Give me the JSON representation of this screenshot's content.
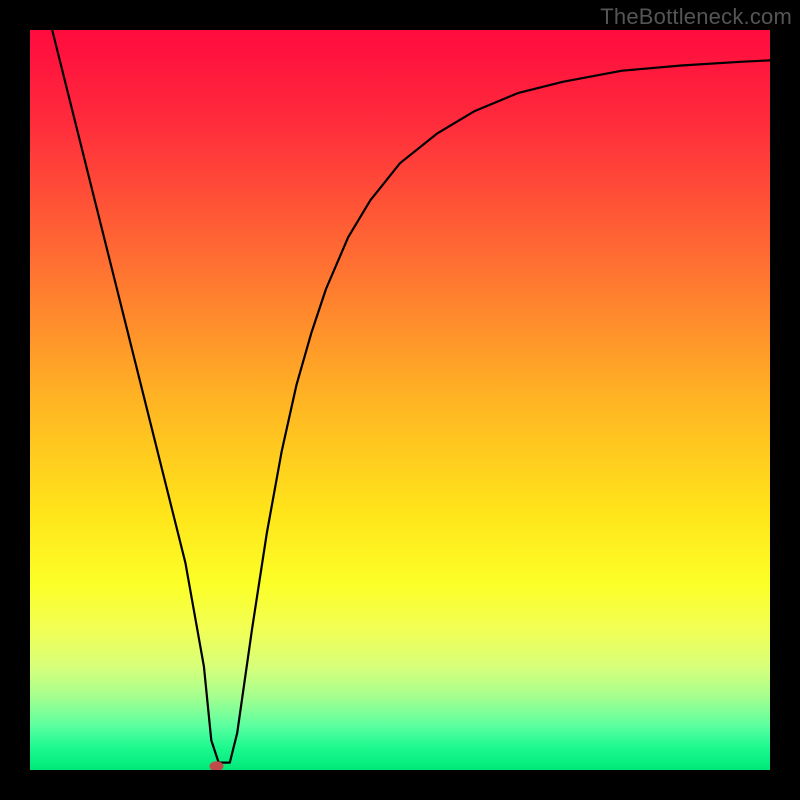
{
  "watermark": "TheBottleneck.com",
  "chart_data": {
    "type": "line",
    "title": "",
    "xlabel": "",
    "ylabel": "",
    "xlim": [
      0,
      100
    ],
    "ylim": [
      0,
      100
    ],
    "background_gradient": {
      "stops": [
        {
          "offset": 0,
          "color": "#ff0b3e"
        },
        {
          "offset": 12,
          "color": "#ff2a3c"
        },
        {
          "offset": 30,
          "color": "#ff6a33"
        },
        {
          "offset": 50,
          "color": "#ffb423"
        },
        {
          "offset": 65,
          "color": "#ffe41a"
        },
        {
          "offset": 75,
          "color": "#fcff28"
        },
        {
          "offset": 81,
          "color": "#f1ff55"
        },
        {
          "offset": 86,
          "color": "#d8ff7a"
        },
        {
          "offset": 90,
          "color": "#a6ff8e"
        },
        {
          "offset": 94,
          "color": "#5cffa0"
        },
        {
          "offset": 97,
          "color": "#1cf98f"
        },
        {
          "offset": 100,
          "color": "#00e879"
        }
      ]
    },
    "series": [
      {
        "name": "bottleneck-curve",
        "color": "#000000",
        "x": [
          3,
          6,
          9,
          12,
          15,
          18,
          21,
          23.5,
          24.5,
          25.5,
          27,
          28,
          29,
          30,
          32,
          34,
          36,
          38,
          40,
          43,
          46,
          50,
          55,
          60,
          66,
          72,
          80,
          88,
          96,
          100
        ],
        "y": [
          100,
          88,
          76,
          64,
          52,
          40,
          28,
          14,
          4,
          1,
          1,
          5,
          12,
          19,
          32,
          43,
          52,
          59,
          65,
          72,
          77,
          82,
          86,
          89,
          91.5,
          93,
          94.5,
          95.2,
          95.7,
          95.9
        ]
      }
    ],
    "marker": {
      "name": "min-point",
      "x": 25.2,
      "y": 0.5,
      "color": "#c14b4b",
      "rx": 7,
      "ry": 5
    }
  }
}
